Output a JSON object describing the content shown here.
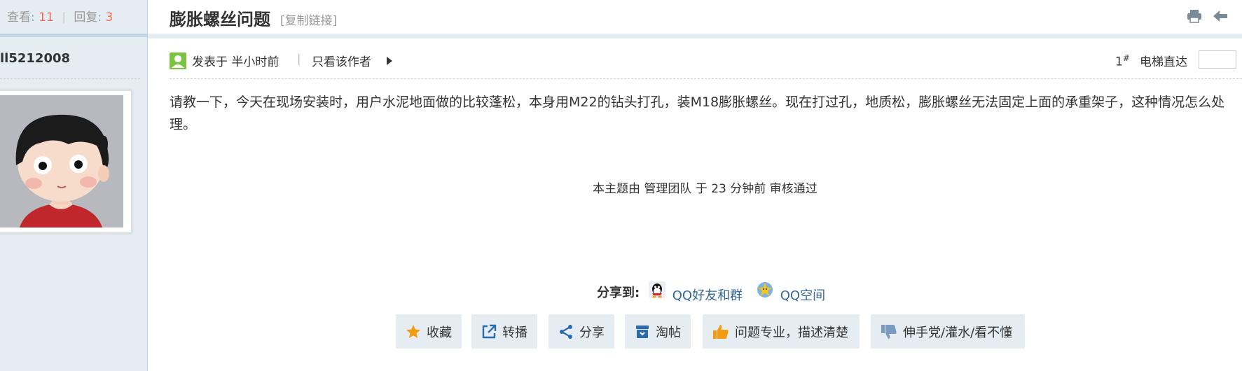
{
  "sidebar": {
    "views_label": "查看:",
    "views_count": "11",
    "separator": "|",
    "replies_label": "回复:",
    "replies_count": "3",
    "author_name": "ll5212008"
  },
  "thread": {
    "title": "膨胀螺丝问题",
    "copy_link": "[复制链接]"
  },
  "post_meta": {
    "posted_at": "发表于 半小时前",
    "separator": "|",
    "only_author": "只看该作者",
    "floor_number": "1",
    "floor_mark": "#",
    "elevator_label": "电梯直达",
    "elevator_value": ""
  },
  "post": {
    "content": "请教一下，今天在现场安装时，用户水泥地面做的比较蓬松，本身用M22的钻头打孔，装M18膨胀螺丝。现在打过孔，地质松，膨胀螺丝无法固定上面的承重架子，这种情况怎么处理。",
    "moderation_note": "本主题由 管理团队 于 23 分钟前 审核通过"
  },
  "share": {
    "label": "分享到:",
    "qq_friends": "QQ好友和群",
    "qq_zone": "QQ空间"
  },
  "actions": {
    "favorite": "收藏",
    "repost": "转播",
    "share": "分享",
    "taobao": "淘帖",
    "upvote": "问题专业，描述清楚",
    "downvote": "伸手党/灌水/看不懂"
  },
  "colors": {
    "accent_number": "#f26c4f",
    "link": "#336699",
    "sidebar_bg": "#e5edf2",
    "button_bg": "#e5edf2",
    "icon_blue": "#2b6cb0",
    "icon_orange": "#f39c12"
  }
}
